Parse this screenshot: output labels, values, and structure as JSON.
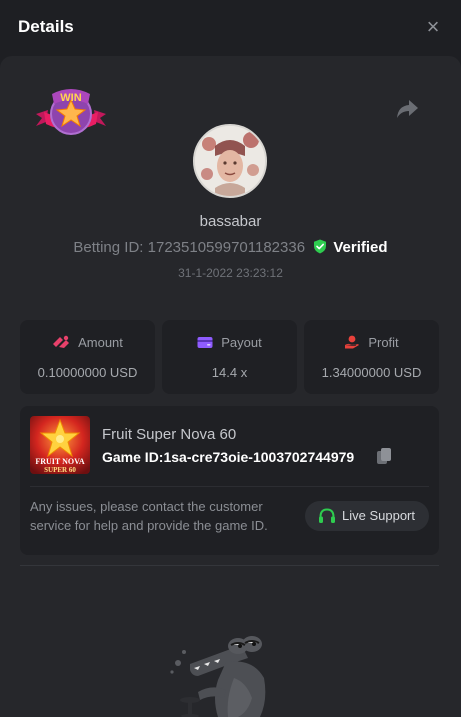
{
  "header": {
    "title": "Details",
    "close_glyph": "×"
  },
  "badge": {
    "text": "WIN"
  },
  "user": {
    "username": "bassabar"
  },
  "bet": {
    "betting_id_label": "Betting ID:",
    "betting_id": "1723510599701182336",
    "verified_label": "Verified",
    "timestamp": "31-1-2022 23:23:12"
  },
  "stats": [
    {
      "label": "Amount",
      "value": "0.10000000 USD",
      "icon": "coins-icon",
      "color": "#e8416b"
    },
    {
      "label": "Payout",
      "value": "14.4 x",
      "icon": "wallet-icon",
      "color": "#8f5cff"
    },
    {
      "label": "Profit",
      "value": "1.34000000 USD",
      "icon": "hand-coin-icon",
      "color": "#e8413b"
    }
  ],
  "game": {
    "name": "Fruit Super Nova 60",
    "id_text": "Game ID:1sa-cre73oie-1003702744979",
    "thumb_line1": "FRUIT NOVA",
    "thumb_line2": "SUPER 60"
  },
  "support": {
    "message": "Any issues, please contact the customer service for help and provide the game ID.",
    "button_label": "Live Support"
  },
  "colors": {
    "background": "#1e1f23",
    "panel": "#26272b",
    "card": "#1f2024",
    "verified_green": "#2ecc4f",
    "support_icon_green": "#2ecc4f"
  }
}
